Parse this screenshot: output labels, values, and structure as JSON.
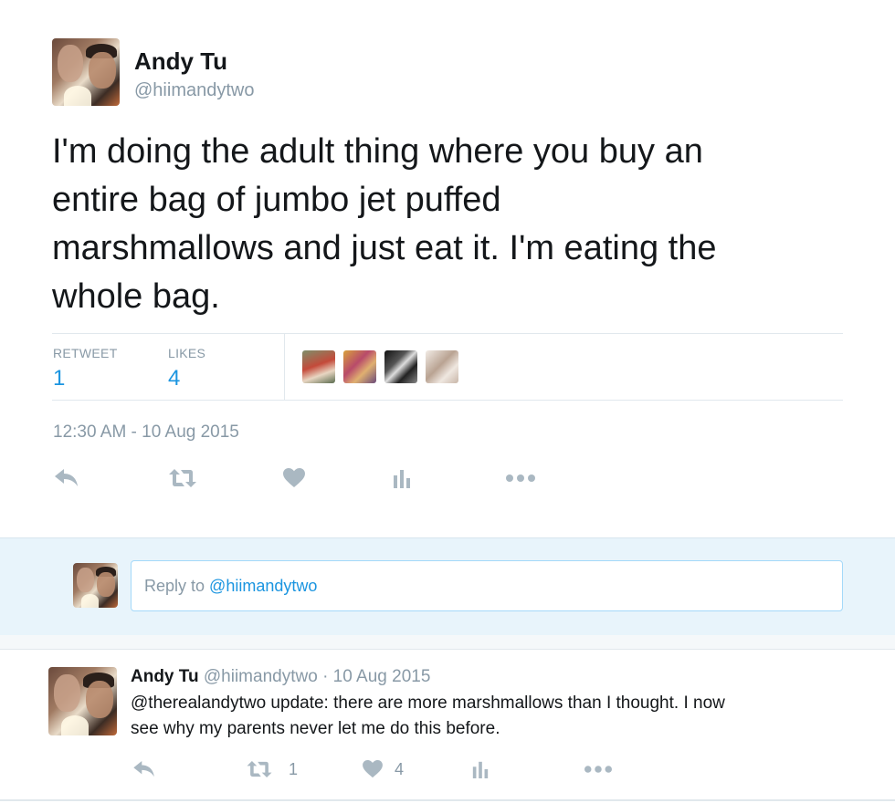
{
  "tweet": {
    "author_name": "Andy Tu",
    "author_handle": "@hiimandytwo",
    "text": "I'm doing the adult thing where you buy an entire bag of jumbo jet puffed marshmallows and just eat it. I'm eating the whole bag.",
    "text_lines": [
      "I'm doing the adult thing where you buy an",
      "entire bag of jumbo jet puffed",
      "marshmallows and just eat it. I'm eating the",
      "whole bag."
    ],
    "stats": {
      "retweet_label": "RETWEET",
      "retweet_count": "1",
      "likes_label": "LIKES",
      "likes_count": "4"
    },
    "timestamp": "12:30 AM - 10 Aug 2015",
    "actions": [
      "reply-icon",
      "retweet-icon",
      "like-icon",
      "analytics-icon",
      "more-icon"
    ]
  },
  "reply_composer": {
    "placeholder_prefix": "Reply to ",
    "placeholder_mention": "@hiimandytwo"
  },
  "reply_tweet": {
    "author_name": "Andy Tu",
    "author_handle": "@hiimandytwo",
    "separator": "·",
    "date": "10 Aug 2015",
    "text_line1": "@therealandytwo update: there are more marshmallows than I thought. I now",
    "text_line2": "see why my parents never let me do this before.",
    "retweet_count": "1",
    "like_count": "4"
  },
  "colors": {
    "accent": "#1b95e0",
    "muted": "#8899a6",
    "icon": "#aab8c2",
    "reply_bar_bg": "#e8f4fb"
  }
}
